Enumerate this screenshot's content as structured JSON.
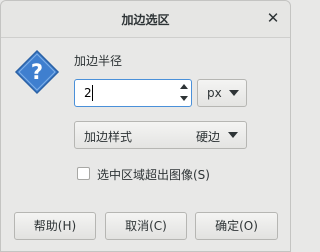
{
  "window": {
    "title": "加边选区",
    "close_glyph": "✕"
  },
  "icon": "question-icon",
  "radius": {
    "label": "加边半径",
    "value": "2",
    "unit": "px"
  },
  "style": {
    "label": "加边样式",
    "value": "硬边"
  },
  "checkbox": {
    "label": "选中区域超出图像(S)",
    "checked": false
  },
  "buttons": {
    "help": "帮助(H)",
    "cancel": "取消(C)",
    "ok": "确定(O)"
  },
  "colors": {
    "accent": "#4a90d9",
    "icon_blue": "#3f7fcf",
    "background": "#e8e8e7"
  }
}
